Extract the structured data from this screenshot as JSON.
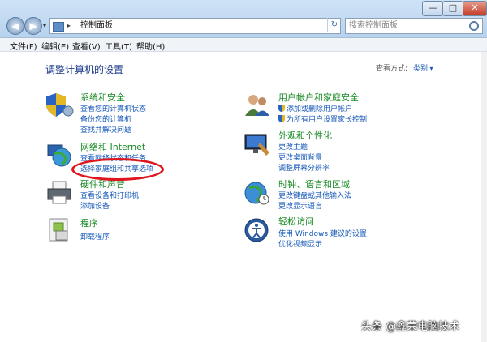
{
  "window": {
    "buttons": {
      "minimize": "—",
      "maximize": "□",
      "close": "✕"
    }
  },
  "address_bar": {
    "text": "控制面板",
    "separator": "▸",
    "dropdown": "▾",
    "refresh_icon": "↻"
  },
  "nav": {
    "back": "◀",
    "forward": "▶",
    "recent": "▾"
  },
  "search": {
    "placeholder": "搜索控制面板"
  },
  "menu": [
    {
      "label": "文件(F)"
    },
    {
      "label": "编辑(E)"
    },
    {
      "label": "查看(V)"
    },
    {
      "label": "工具(T)"
    },
    {
      "label": "帮助(H)"
    }
  ],
  "main": {
    "title": "调整计算机的设置",
    "view_by_label": "查看方式:",
    "view_by_value": "类别",
    "categories": [
      {
        "title": "系统和安全",
        "links": [
          "查看您的计算机状态",
          "备份您的计算机",
          "查找并解决问题"
        ]
      },
      {
        "title": "网络和 Internet",
        "links": [
          "查看网络状态和任务",
          "选择家庭组和共享选项"
        ]
      },
      {
        "title": "硬件和声音",
        "links": [
          "查看设备和打印机",
          "添加设备"
        ]
      },
      {
        "title": "程序",
        "links": [
          "卸载程序"
        ]
      },
      {
        "title": "用户帐户和家庭安全",
        "links": [
          "添加或删除用户帐户",
          "为所有用户设置家长控制"
        ]
      },
      {
        "title": "外观和个性化",
        "links": [
          "更改主题",
          "更改桌面背景",
          "调整屏幕分辨率"
        ]
      },
      {
        "title": "时钟、语言和区域",
        "links": [
          "更改键盘或其他输入法",
          "更改显示语言"
        ]
      },
      {
        "title": "轻松访问",
        "links": [
          "使用 Windows 建议的设置",
          "优化视频显示"
        ]
      }
    ]
  },
  "watermark": "头条 @鑫荣电脑技术",
  "colors": {
    "category_title": "#1a8a25",
    "link": "#1457b8",
    "annotation": "#e0141c"
  }
}
